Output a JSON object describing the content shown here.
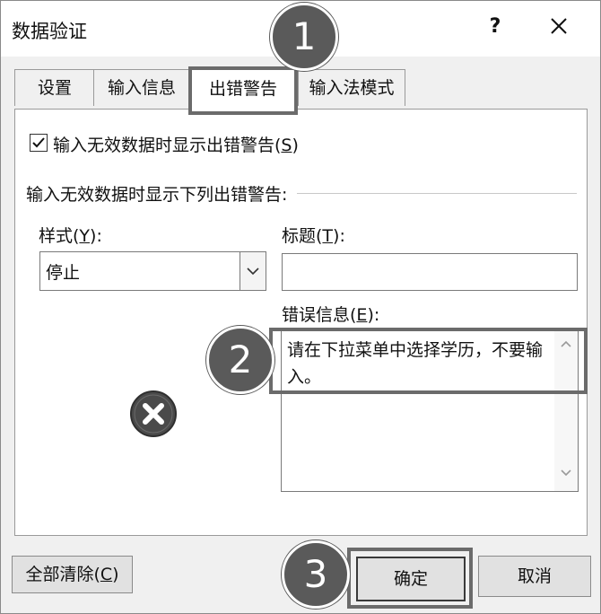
{
  "window": {
    "title": "数据验证",
    "help_label": "?"
  },
  "tabs": [
    {
      "label": "设置",
      "active": false
    },
    {
      "label": "输入信息",
      "active": false
    },
    {
      "label": "出错警告",
      "active": true
    },
    {
      "label": "输入法模式",
      "active": false
    }
  ],
  "error_alert": {
    "show_alert_label": "输入无效数据时显示出错警告(",
    "show_alert_key": "S",
    "show_alert_suffix": ")",
    "show_alert_checked": true,
    "group_title": "输入无效数据时显示下列出错警告:",
    "style_label": "样式(",
    "style_key": "Y",
    "style_suffix": "):",
    "style_value": "停止",
    "title_label": "标题(",
    "title_key": "T",
    "title_suffix": "):",
    "title_value": "",
    "message_label": "错误信息(",
    "message_key": "E",
    "message_suffix": "):",
    "message_value": "请在下拉菜单中选择学历，不要输入。",
    "style_icon": "stop-error-icon"
  },
  "buttons": {
    "clear_all_label": "全部清除(",
    "clear_all_key": "C",
    "clear_all_suffix": ")",
    "ok_label": "确定",
    "cancel_label": "取消"
  },
  "callouts": [
    "1",
    "2",
    "3"
  ],
  "colors": {
    "dialog_bg": "#f0f0f0",
    "highlight_border": "#6b6b6b",
    "callout_fill": "#5a5a5a",
    "stop_icon": "#4a4a4a"
  }
}
